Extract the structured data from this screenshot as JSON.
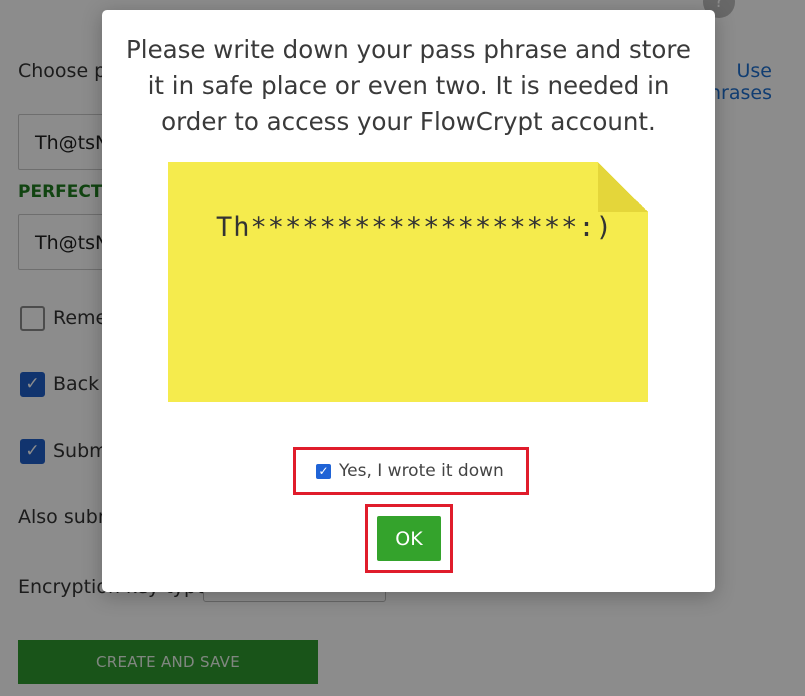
{
  "background": {
    "help_icon": "?",
    "choose_label": "Choose pass phrase",
    "link_label": "Use passphrases",
    "passphrase_value": "Th@tsNotAPassphrase",
    "passphrase_confirm_value": "Th@tsNotAPassphrase",
    "strength_label": "PERFECT",
    "checkboxes": [
      {
        "label": "Remember pass phrase",
        "checked": false
      },
      {
        "label": "Back up encrypted key",
        "checked": true
      },
      {
        "label": "Submit public key",
        "checked": true
      }
    ],
    "also_submit_label": "Also submit",
    "encryption_label": "Encryption key type",
    "create_button": "CREATE AND SAVE"
  },
  "modal": {
    "message": "Please write down your pass phrase and store it in safe place or even two. It is needed in order to access your FlowCrypt account.",
    "note_text": "Th*******************:)",
    "confirm_label": "Yes, I wrote it down",
    "confirm_checked": true,
    "ok_button": "OK"
  },
  "colors": {
    "note_yellow": "#f5eb4d",
    "ok_green": "#34a32c",
    "highlight_red": "#e01c2b",
    "link_blue": "#1e6fd0"
  }
}
